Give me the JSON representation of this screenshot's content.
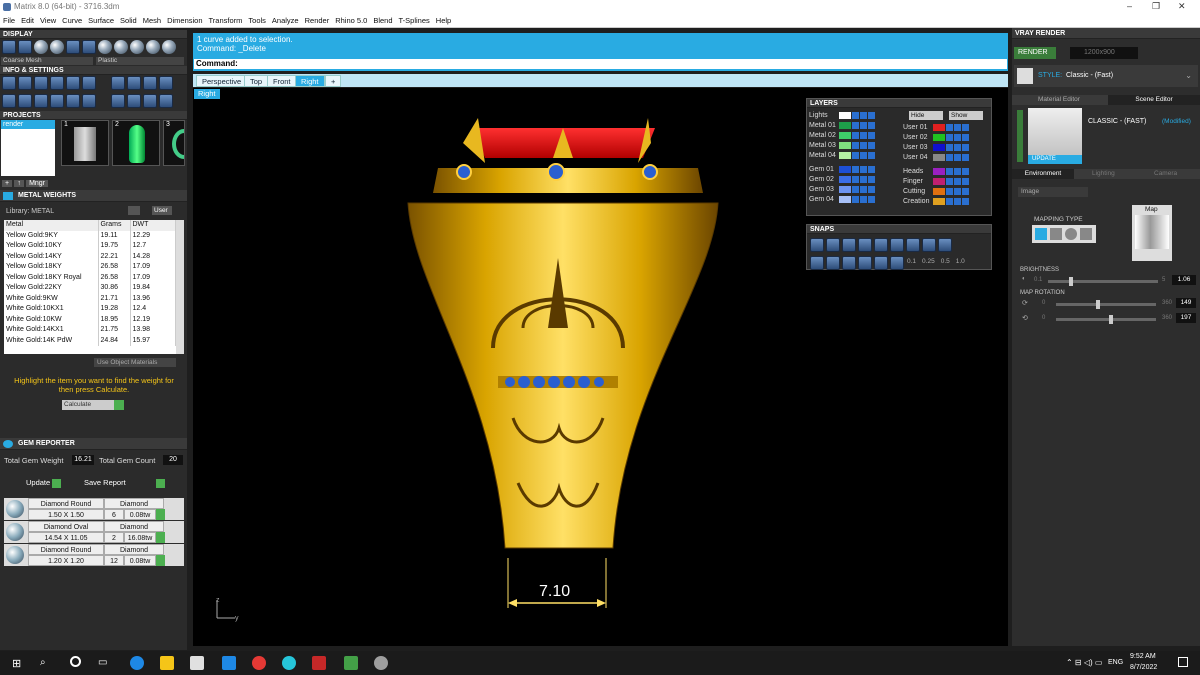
{
  "window": {
    "title": "Matrix 8.0 (64-bit) - 3716.3dm",
    "controls": [
      "–",
      "❐",
      "✕"
    ]
  },
  "menu": [
    "File",
    "Edit",
    "View",
    "Curve",
    "Surface",
    "Solid",
    "Mesh",
    "Dimension",
    "Transform",
    "Tools",
    "Analyze",
    "Render",
    "Rhino 5.0",
    "Blend",
    "T-Splines",
    "Help"
  ],
  "display": {
    "header": "DISPLAY",
    "mesh_select": "Coarse Mesh",
    "material_select": "Plastic"
  },
  "info": {
    "header": "INFO & SETTINGS"
  },
  "projects": {
    "header": "PROJECTS",
    "list_item": "render",
    "thumbs": [
      "1",
      "2",
      "3"
    ],
    "buttons": [
      "+",
      "↑",
      "Mngr"
    ]
  },
  "metal_weights": {
    "header": "METAL WEIGHTS",
    "library_label": "Library: METAL",
    "unit_btn": "User",
    "columns": [
      "Metal",
      "Grams",
      "DWT"
    ],
    "rows": [
      [
        "Yellow Gold:9KY",
        "19.11",
        "12.29"
      ],
      [
        "Yellow Gold:10KY",
        "19.75",
        "12.7"
      ],
      [
        "Yellow Gold:14KY",
        "22.21",
        "14.28"
      ],
      [
        "Yellow Gold:18KY",
        "26.58",
        "17.09"
      ],
      [
        "Yellow Gold:18KY Royal",
        "26.58",
        "17.09"
      ],
      [
        "Yellow Gold:22KY",
        "30.86",
        "19.84"
      ],
      [
        "White Gold:9KW",
        "21.71",
        "13.96"
      ],
      [
        "White Gold:10KX1",
        "19.28",
        "12.4"
      ],
      [
        "White Gold:10KW",
        "18.95",
        "12.19"
      ],
      [
        "White Gold:14KX1",
        "21.75",
        "13.98"
      ],
      [
        "White Gold:14K PdW",
        "24.84",
        "15.97"
      ]
    ],
    "use_object": "Use Object Materials",
    "hint": "Highlight the item you want to find the weight for then press Calculate.",
    "calculate": "Calculate"
  },
  "gem_reporter": {
    "header": "GEM REPORTER",
    "total_weight_label": "Total Gem Weight",
    "total_weight": "16.21",
    "total_count_label": "Total Gem Count",
    "total_count": "20",
    "update": "Update",
    "save": "Save Report",
    "gems": [
      {
        "shape": "Diamond Round",
        "type": "Diamond",
        "size": "1.50 X 1.50",
        "count": "6",
        "weight": "0.08tw"
      },
      {
        "shape": "Diamond Oval",
        "type": "Diamond",
        "size": "14.54 X 11.05",
        "count": "2",
        "weight": "16.08tw"
      },
      {
        "shape": "Diamond Round",
        "type": "Diamond",
        "size": "1.20 X 1.20",
        "count": "12",
        "weight": "0.08tw"
      }
    ]
  },
  "command": {
    "history1": "1 curve added to selection.",
    "history2": "Command: _Delete",
    "label": "Command:"
  },
  "tabs": [
    "Perspective",
    "Top",
    "Front",
    "Right",
    "+"
  ],
  "viewport": {
    "name": "Right",
    "dimension": "7.10",
    "axis_z": "z",
    "axis_y": "y"
  },
  "layers": {
    "header": "LAYERS",
    "hide": "Hide",
    "show": "Show",
    "left": [
      {
        "name": "Lights",
        "color": "#ffffff"
      },
      {
        "name": "Metal 01",
        "color": "#1e9e4a"
      },
      {
        "name": "Metal 02",
        "color": "#3ecf6a"
      },
      {
        "name": "Metal 03",
        "color": "#7fe07f"
      },
      {
        "name": "Metal 04",
        "color": "#b5f0a5"
      },
      {
        "name": "Gem 01",
        "color": "#1d4fd6"
      },
      {
        "name": "Gem 02",
        "color": "#3b6ee8"
      },
      {
        "name": "Gem 03",
        "color": "#6e95f2"
      },
      {
        "name": "Gem 04",
        "color": "#a7c0f7"
      }
    ],
    "right": [
      {
        "name": "User 01",
        "color": "#e02020"
      },
      {
        "name": "User 02",
        "color": "#20c020"
      },
      {
        "name": "User 03",
        "color": "#1010d0"
      },
      {
        "name": "User 04",
        "color": "#888888"
      },
      {
        "name": "Heads",
        "color": "#9a20c0"
      },
      {
        "name": "Finger",
        "color": "#c02070"
      },
      {
        "name": "Cutting",
        "color": "#e07010"
      },
      {
        "name": "Creation",
        "color": "#e0a020"
      }
    ]
  },
  "snaps": {
    "header": "SNAPS",
    "values": [
      "0.1",
      "0.25",
      "0.5",
      "1.0"
    ]
  },
  "vray": {
    "header": "VRAY RENDER",
    "render_btn": "RENDER",
    "resolution": "1200x900",
    "style_label": "STYLE:",
    "style_value": "Classic - (Fast)",
    "tab_material": "Material Editor",
    "tab_scene": "Scene Editor",
    "scene_name": "CLASSIC - (FAST)",
    "modified": "(Modified)",
    "update": "UPDATE",
    "env_tabs": [
      "Environment",
      "Lighting",
      "Camera"
    ],
    "env_select": "Image",
    "mapping_type": "MAPPING TYPE",
    "map_label": "Map",
    "brightness_label": "BRIGHTNESS",
    "brightness_min": "0.1",
    "brightness_max": "5",
    "brightness": "1.06",
    "rotation_label": "MAP ROTATION",
    "rot_min": "0",
    "rot_max": "360",
    "rot1": "149",
    "rot2": "197"
  },
  "taskbar": {
    "time": "9:52 AM",
    "date": "8/7/2022",
    "lang": "ENG"
  }
}
